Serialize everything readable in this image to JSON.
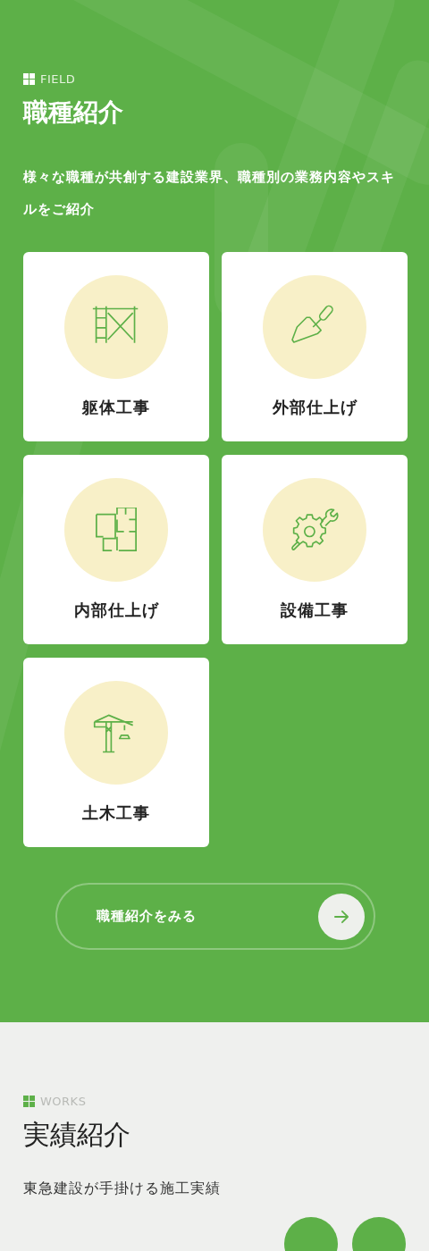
{
  "field_section": {
    "eyebrow": "FIELD",
    "title": "職種紹介",
    "description": "様々な職種が共創する建設業界、職種別の業務内容やスキルをご紹介",
    "cards": [
      {
        "kind": "scaffold",
        "label": "躯体工事"
      },
      {
        "kind": "trowel",
        "label": "外部仕上げ"
      },
      {
        "kind": "floorplan",
        "label": "内部仕上げ"
      },
      {
        "kind": "gear-wrench",
        "label": "設備工事"
      },
      {
        "kind": "crane",
        "label": "土木工事"
      }
    ],
    "button": {
      "label": "職種紹介をみる"
    }
  },
  "works_section": {
    "eyebrow": "WORKS",
    "title": "実績紹介",
    "description": "東急建設が手掛ける施工実績"
  }
}
